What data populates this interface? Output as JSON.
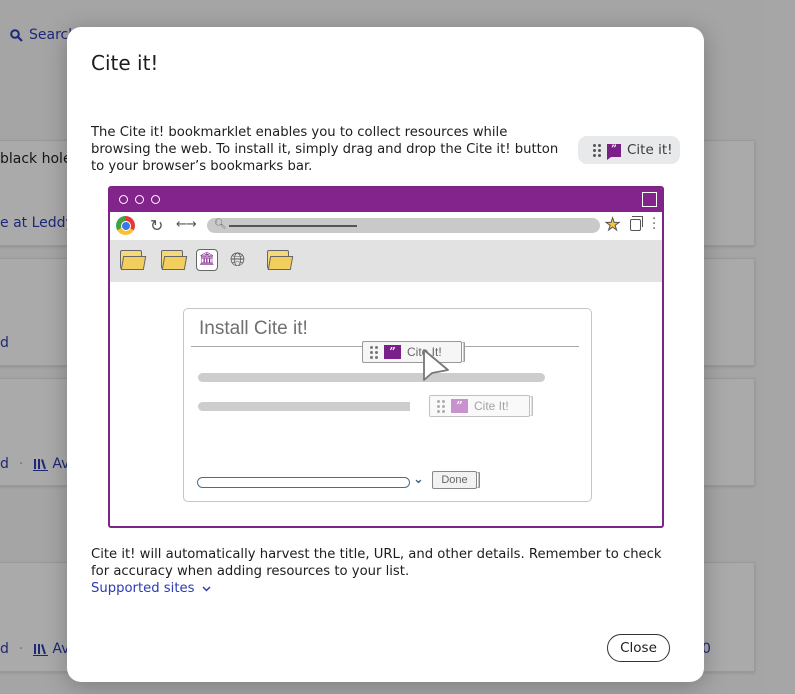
{
  "background": {
    "search_link": "Search",
    "cards": [
      {
        "title_fragment": "black hole",
        "link_fragment": "e at Leddy"
      },
      {
        "link_fragment": "d"
      },
      {
        "link_fragment": "d",
        "availability_fragment": "Av"
      },
      {
        "link_fragment": "d",
        "availability_fragment": "Av",
        "right_fragment": "0"
      }
    ]
  },
  "modal": {
    "title": "Cite it!",
    "intro": "The Cite it! bookmarklet enables you to collect resources while browsing the web. To install it, simply drag and drop the Cite it! button to your browser’s bookmarks bar.",
    "bookmarklet_label": "Cite it!",
    "illustration": {
      "install_title": "Install Cite it!",
      "dragged_button_label": "Cite It!",
      "placed_button_label": "Cite It!",
      "done_label": "Done",
      "quote_glyph": "”"
    },
    "outro": "Cite it! will automatically harvest the title, URL, and other details. Remember to check for accuracy when adding resources to your list.",
    "supported_sites_label": "Supported sites",
    "close_label": "Close"
  },
  "colors": {
    "brand_purple": "#82248b",
    "link_blue": "#2b3bb0",
    "folder_yellow": "#f1ce5e"
  }
}
